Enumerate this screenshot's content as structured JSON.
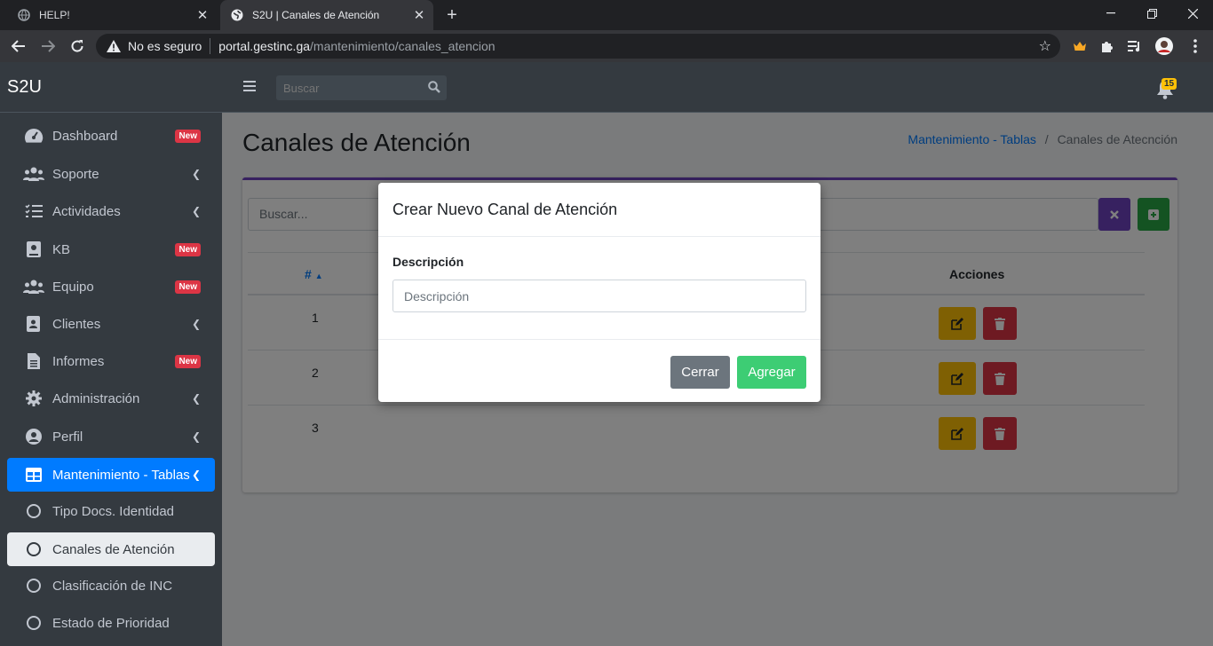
{
  "browser": {
    "tabs": [
      {
        "title": "HELP!",
        "active": false
      },
      {
        "title": "S2U | Canales de Atención",
        "active": true
      }
    ],
    "address": {
      "security_label": "No es seguro",
      "host": "portal.gestinc.ga",
      "path": "/mantenimiento/canales_atencion"
    }
  },
  "app": {
    "brand": "S2U",
    "search_placeholder": "Buscar",
    "notifications_count": "15"
  },
  "sidebar": {
    "items": [
      {
        "label": "Dashboard",
        "badge": "New",
        "icon": "dashboard-icon"
      },
      {
        "label": "Soporte",
        "icon": "users-icon"
      },
      {
        "label": "Actividades",
        "icon": "tasks-icon"
      },
      {
        "label": "KB",
        "badge": "New",
        "icon": "book-icon"
      },
      {
        "label": "Equipo",
        "badge": "New",
        "icon": "users-icon"
      },
      {
        "label": "Clientes",
        "icon": "contact-book-icon"
      },
      {
        "label": "Informes",
        "badge": "New",
        "icon": "file-icon"
      },
      {
        "label": "Administración",
        "icon": "gear-icon"
      },
      {
        "label": "Perfil",
        "icon": "user-circle-icon"
      },
      {
        "label": "Mantenimiento - Tablas",
        "icon": "table-icon"
      },
      {
        "label": "Tipo Docs. Identidad",
        "icon": "circle-icon"
      },
      {
        "label": "Canales de Atención",
        "icon": "circle-icon"
      },
      {
        "label": "Clasificación de INC",
        "icon": "circle-icon"
      },
      {
        "label": "Estado de Prioridad",
        "icon": "circle-icon"
      }
    ]
  },
  "page": {
    "title": "Canales de Atención",
    "breadcrumb": {
      "parent": "Mantenimiento - Tablas",
      "separator": "/",
      "current": "Canales de Atecnción"
    },
    "search_placeholder": "Buscar...",
    "table": {
      "headers": {
        "num": "#",
        "actions": "Acciones"
      },
      "rows": [
        {
          "num": "1"
        },
        {
          "num": "2"
        },
        {
          "num": "3"
        }
      ]
    }
  },
  "modal": {
    "title": "Crear Nuevo Canal de Atención",
    "field_label": "Descripción",
    "field_placeholder": "Descripción",
    "close_label": "Cerrar",
    "add_label": "Agregar"
  },
  "colors": {
    "accent_purple": "#6f42c1",
    "success": "#28a745",
    "warning": "#ffc107",
    "danger": "#dc3545",
    "primary": "#007bff",
    "secondary": "#6c757d"
  }
}
